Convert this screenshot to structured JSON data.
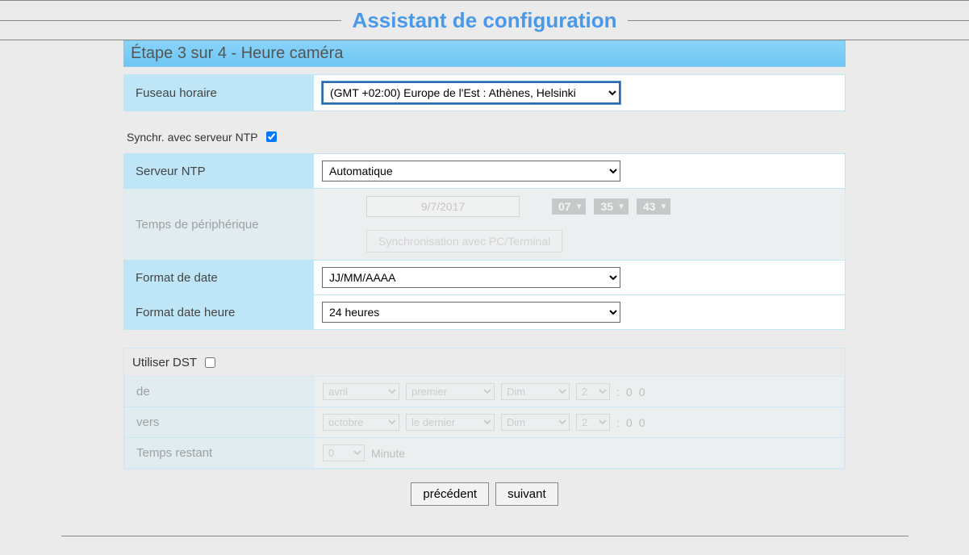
{
  "title": "Assistant de configuration",
  "step_header": "Étape 3 sur 4 - Heure caméra",
  "tz": {
    "label": "Fuseau horaire",
    "selected": "(GMT +02:00) Europe de l'Est : Athènes, Helsinki"
  },
  "ntp_sync": {
    "label": "Synchr. avec serveur NTP",
    "checked": true
  },
  "ntp_server": {
    "label": "Serveur NTP",
    "selected": "Automatique"
  },
  "device_time": {
    "label": "Temps de périphérique",
    "date": "9/7/2017",
    "hh": "07",
    "mm": "35",
    "ss": "43",
    "sync_button": "Synchronisation avec PC/Terminal"
  },
  "date_format": {
    "label": "Format de date",
    "selected": "JJ/MM/AAAA"
  },
  "time_format": {
    "label": "Format date heure",
    "selected": "24 heures"
  },
  "dst": {
    "use_label": "Utiliser DST",
    "checked": false,
    "from": {
      "label": "de",
      "month": "avril",
      "ordinal": "premier",
      "day": "Dim",
      "hour": "2",
      "hh": "0",
      "mm": "0"
    },
    "to": {
      "label": "vers",
      "month": "octobre",
      "ordinal": "le dernier",
      "day": "Dim",
      "hour": "2",
      "hh": "0",
      "mm": "0"
    },
    "offset": {
      "label": "Temps restant",
      "value": "0",
      "unit": "Minute"
    }
  },
  "nav": {
    "prev": "précédent",
    "next": "suivant"
  }
}
